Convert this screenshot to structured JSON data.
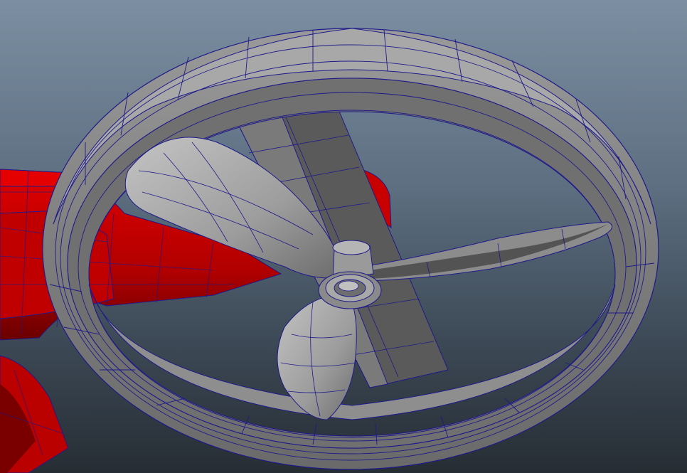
{
  "viewport": {
    "background_top": "#7c8fa2",
    "background_bottom": "#262d34"
  },
  "colors": {
    "wireframe": "#1e1a8a",
    "shell_red": "#d40000",
    "shell_red_dark": "#7a0000",
    "metal_light": "#b3b3b3",
    "metal_mid": "#8a8a8a",
    "metal_dark": "#4a4a4a"
  },
  "objects": [
    "red-fuselage",
    "duct-ring",
    "support-strut",
    "propeller-hub",
    "propeller-blade-upper",
    "propeller-blade-lower",
    "propeller-blade-right"
  ]
}
